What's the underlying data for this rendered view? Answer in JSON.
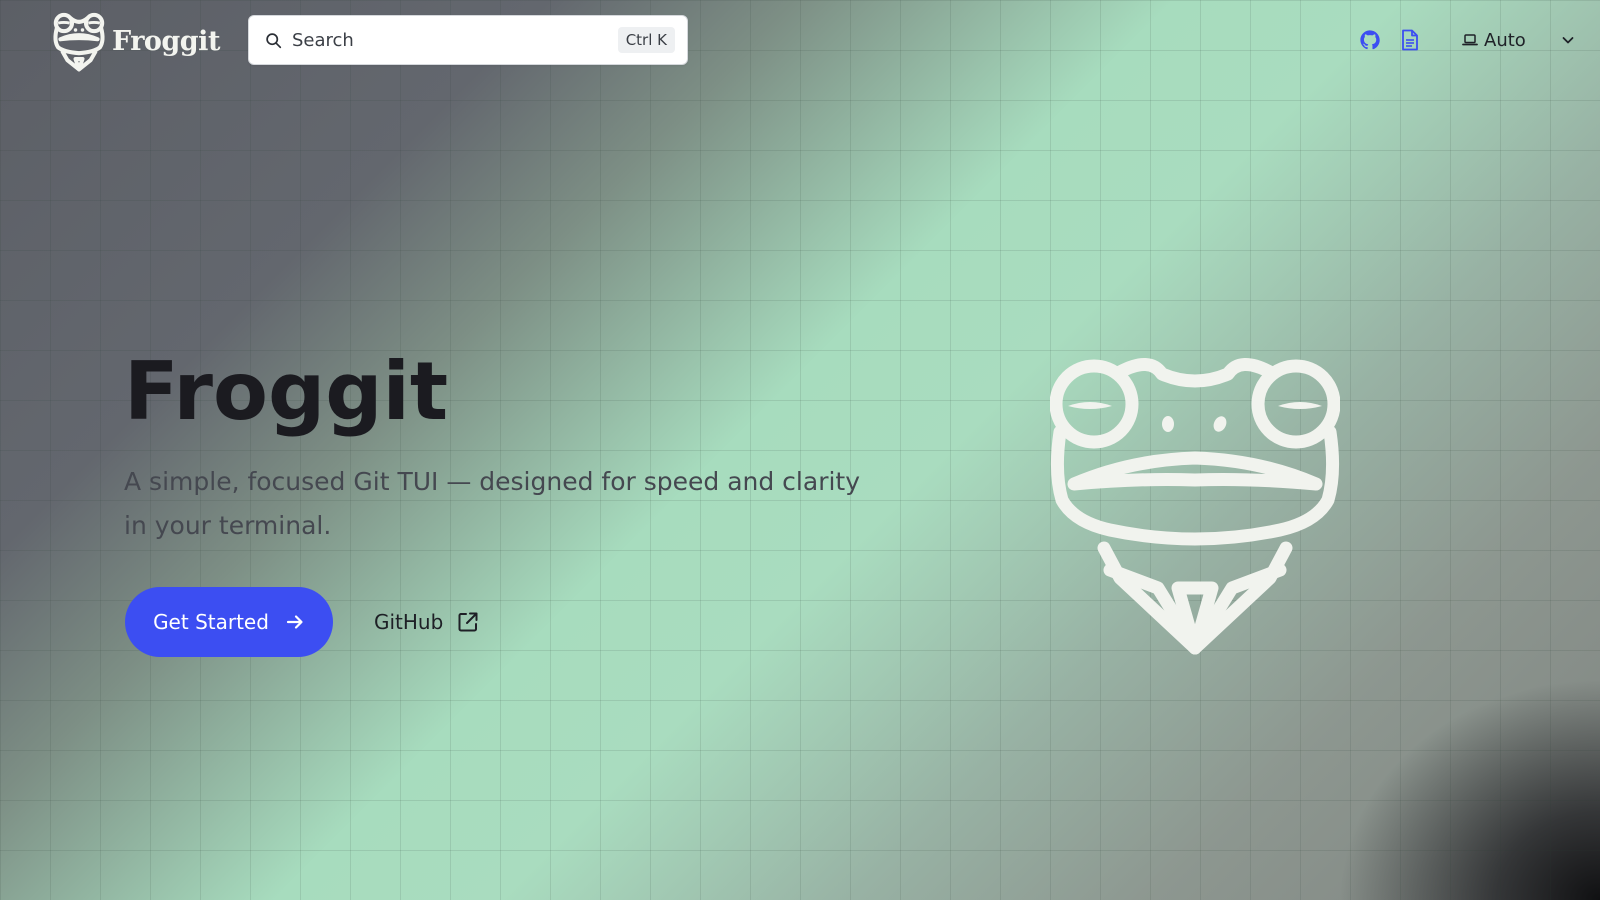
{
  "header": {
    "brand_name": "Froggit",
    "search": {
      "placeholder": "Search",
      "shortcut": "Ctrl K"
    },
    "icons": [
      "github-icon",
      "document-icon"
    ],
    "theme": {
      "selected": "Auto",
      "icon": "laptop-icon"
    }
  },
  "hero": {
    "title": "Froggit",
    "tagline": "A simple, focused Git TUI — designed for speed and clarity in your terminal.",
    "primary_button": {
      "label": "Get Started",
      "icon": "arrow-right-icon"
    },
    "secondary_link": {
      "label": "GitHub",
      "icon": "external-link-icon"
    },
    "image": "frog-mascot-illustration"
  },
  "colors": {
    "accent": "#3c4ef2",
    "brand_text": "#f3f4ef",
    "title_text": "#1b1b20",
    "tagline_text": "#454850",
    "icon_accent": "#3c4ef2"
  }
}
